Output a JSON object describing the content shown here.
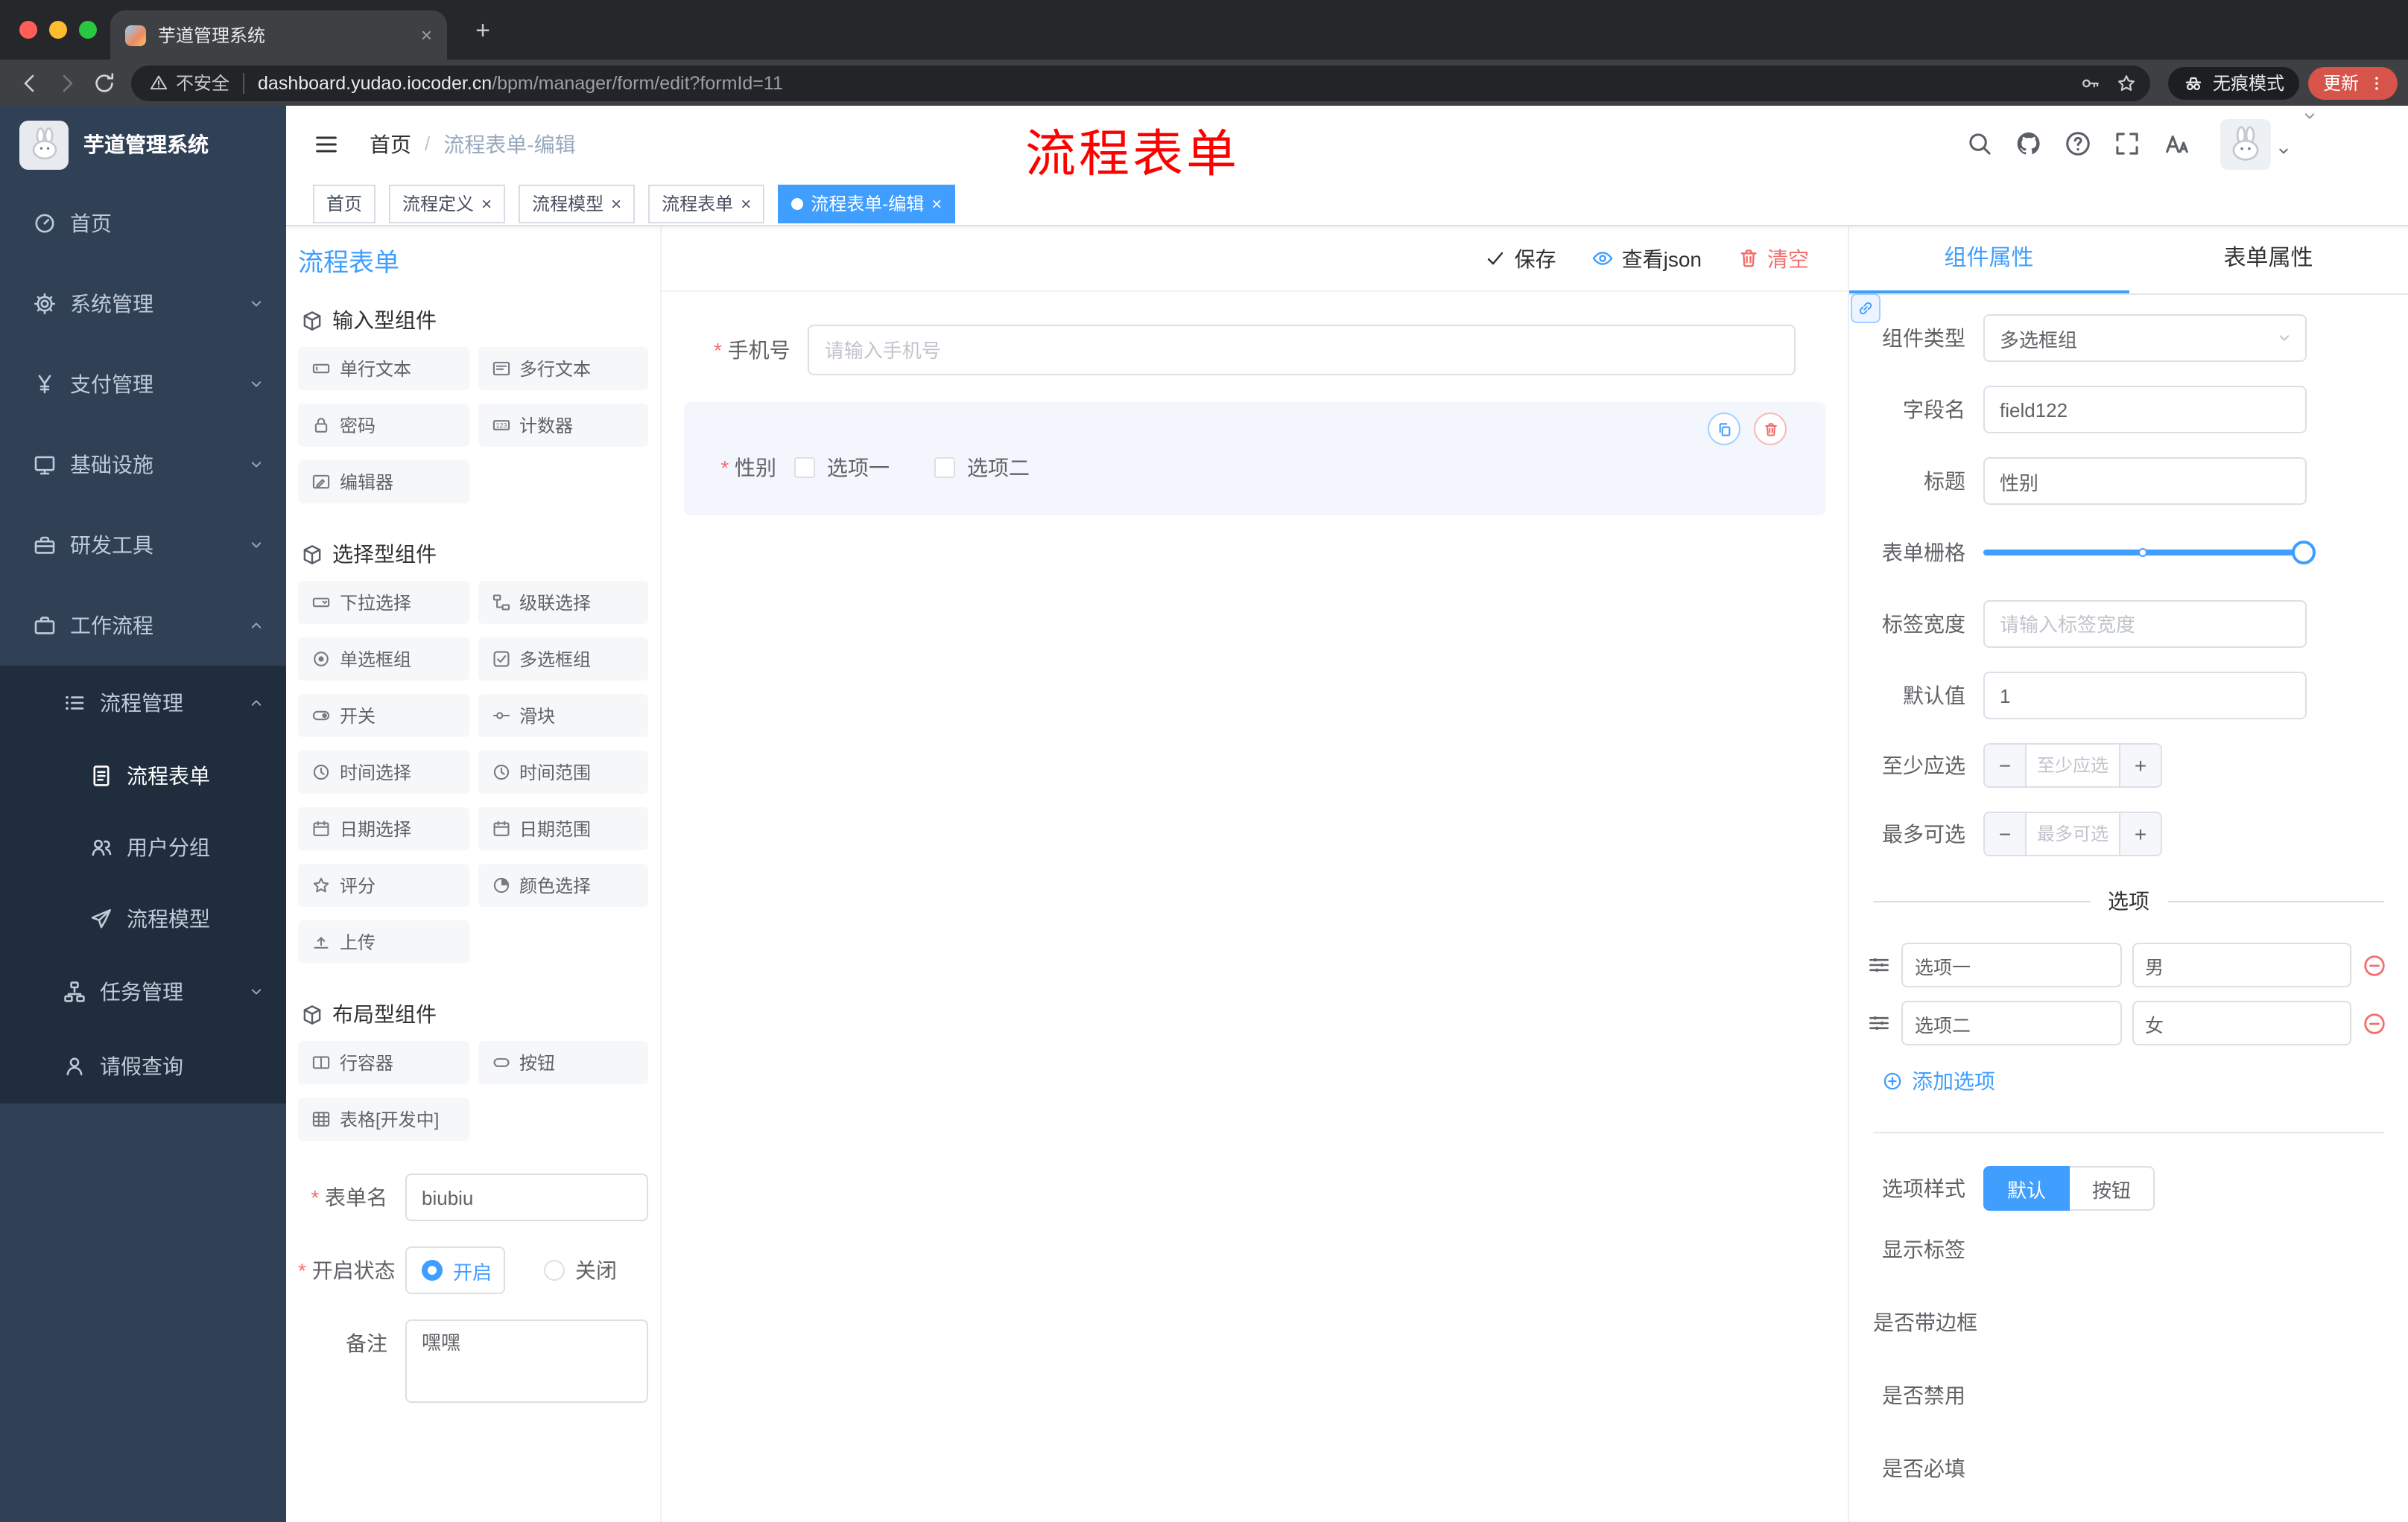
{
  "colors": {
    "accent": "#409eff",
    "danger": "#f56c6c",
    "annotation_red": "#ff0000",
    "sidebar_bg": "#304156",
    "sidebar_submenu_bg": "#1f2d3d",
    "active_tag_bg": "#409eff"
  },
  "browser": {
    "tab_title": "芋道管理系统",
    "new_tab": "+",
    "security_label": "不安全",
    "url_domain": "dashboard.yudao.iocoder.cn",
    "url_path": "/bpm/manager/form/edit?formId=11",
    "incognito_label": "无痕模式",
    "update_label": "更新"
  },
  "sidebar": {
    "logo_title": "芋道管理系统",
    "items": [
      {
        "label": "首页",
        "icon": "dashboard-icon"
      },
      {
        "label": "系统管理",
        "icon": "gear-icon"
      },
      {
        "label": "支付管理",
        "icon": "yen-icon"
      },
      {
        "label": "基础设施",
        "icon": "monitor-icon"
      },
      {
        "label": "研发工具",
        "icon": "toolbox-icon"
      },
      {
        "label": "工作流程",
        "icon": "briefcase-icon"
      },
      {
        "label": "流程管理",
        "icon": "list-icon"
      },
      {
        "label": "流程表单",
        "icon": "document-icon"
      },
      {
        "label": "用户分组",
        "icon": "users-icon"
      },
      {
        "label": "流程模型",
        "icon": "send-icon"
      },
      {
        "label": "任务管理",
        "icon": "tree-icon"
      },
      {
        "label": "请假查询",
        "icon": "user-icon"
      }
    ]
  },
  "header": {
    "breadcrumb_home": "首页",
    "breadcrumb_separator": "/",
    "breadcrumb_current": "流程表单-编辑",
    "annotation": "流程表单"
  },
  "tags": [
    {
      "label": "首页"
    },
    {
      "label": "流程定义"
    },
    {
      "label": "流程模型"
    },
    {
      "label": "流程表单"
    },
    {
      "label": "流程表单-编辑"
    }
  ],
  "designer": {
    "title": "流程表单",
    "actions": {
      "save": "保存",
      "view_json": "查看json",
      "clear": "清空"
    },
    "palette": {
      "sections": [
        {
          "title": "输入型组件",
          "items": [
            {
              "label": "单行文本",
              "icon": "input-icon"
            },
            {
              "label": "多行文本",
              "icon": "textarea-icon"
            },
            {
              "label": "密码",
              "icon": "lock-icon"
            },
            {
              "label": "计数器",
              "icon": "counter-icon"
            },
            {
              "label": "编辑器",
              "icon": "editor-icon"
            }
          ]
        },
        {
          "title": "选择型组件",
          "items": [
            {
              "label": "下拉选择",
              "icon": "select-icon"
            },
            {
              "label": "级联选择",
              "icon": "cascader-icon"
            },
            {
              "label": "单选框组",
              "icon": "radio-icon"
            },
            {
              "label": "多选框组",
              "icon": "checkbox-icon"
            },
            {
              "label": "开关",
              "icon": "switch-icon"
            },
            {
              "label": "滑块",
              "icon": "slider-icon"
            },
            {
              "label": "时间选择",
              "icon": "time-icon"
            },
            {
              "label": "时间范围",
              "icon": "time-range-icon"
            },
            {
              "label": "日期选择",
              "icon": "date-icon"
            },
            {
              "label": "日期范围",
              "icon": "date-range-icon"
            },
            {
              "label": "评分",
              "icon": "rate-icon"
            },
            {
              "label": "颜色选择",
              "icon": "color-icon"
            },
            {
              "label": "上传",
              "icon": "upload-icon"
            }
          ]
        },
        {
          "title": "布局型组件",
          "items": [
            {
              "label": "行容器",
              "icon": "row-icon"
            },
            {
              "label": "按钮",
              "icon": "button-icon"
            },
            {
              "label": "表格[开发中]",
              "icon": "table-icon"
            }
          ]
        }
      ]
    },
    "config": {
      "name_label": "表单名",
      "name_value": "biubiu",
      "status_label": "开启状态",
      "status_on": "开启",
      "status_off": "关闭",
      "remark_label": "备注",
      "remark_value": "嘿嘿"
    },
    "canvas": {
      "phone_label": "手机号",
      "phone_placeholder": "请输入手机号",
      "gender_label": "性别",
      "gender_option1": "选项一",
      "gender_option2": "选项二"
    }
  },
  "props": {
    "tab_component": "组件属性",
    "tab_form": "表单属性",
    "type_label": "组件类型",
    "type_value": "多选框组",
    "field_label": "字段名",
    "field_value": "field122",
    "title_label": "标题",
    "title_value": "性别",
    "grid_label": "表单栅格",
    "width_label": "标签宽度",
    "width_placeholder": "请输入标签宽度",
    "default_label": "默认值",
    "default_value": "1",
    "min_label": "至少应选",
    "min_placeholder": "至少应选",
    "max_label": "最多可选",
    "max_placeholder": "最多可选",
    "minus": "−",
    "plus": "+",
    "options_title": "选项",
    "options": [
      {
        "label": "选项一",
        "value": "男"
      },
      {
        "label": "选项二",
        "value": "女"
      }
    ],
    "add_option": "添加选项",
    "style_label": "选项样式",
    "style_default": "默认",
    "style_button": "按钮",
    "switch_show_label": "显示标签",
    "switch_border": "是否带边框",
    "switch_disabled": "是否禁用",
    "switch_required": "是否必填"
  }
}
